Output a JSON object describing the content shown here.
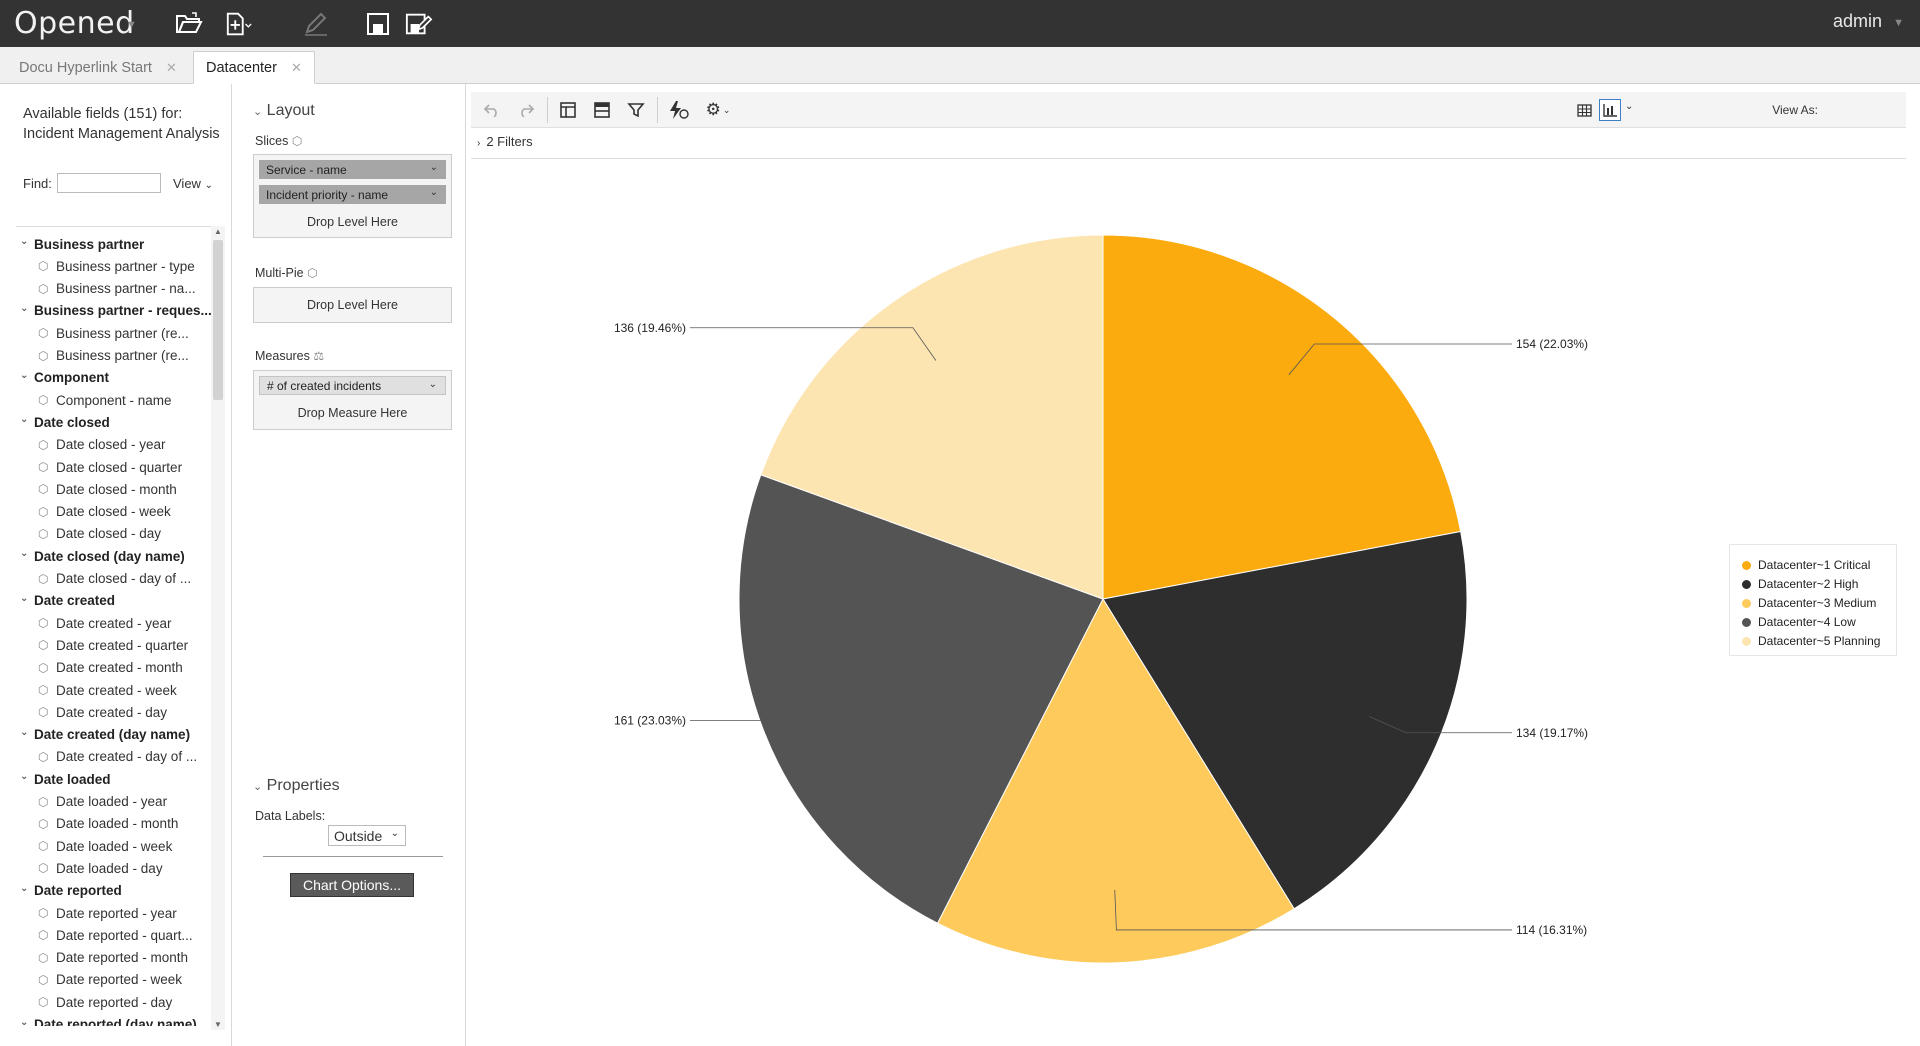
{
  "header": {
    "title": "Opened",
    "user": "admin"
  },
  "tabs": [
    {
      "label": "Docu Hyperlink Start"
    },
    {
      "label": "Datacenter"
    }
  ],
  "fields": {
    "available": "Available fields (151) for: Incident Management Analysis",
    "find_label": "Find:",
    "view_label": "View",
    "tree": [
      {
        "label": "Business partner",
        "group": true
      },
      {
        "label": "Business partner - type",
        "group": false
      },
      {
        "label": "Business partner - na...",
        "group": false
      },
      {
        "label": "Business partner - reques...",
        "group": true
      },
      {
        "label": "Business partner (re...",
        "group": false
      },
      {
        "label": "Business partner (re...",
        "group": false
      },
      {
        "label": "Component",
        "group": true
      },
      {
        "label": "Component - name",
        "group": false
      },
      {
        "label": "Date closed",
        "group": true
      },
      {
        "label": "Date closed - year",
        "group": false
      },
      {
        "label": "Date closed - quarter",
        "group": false
      },
      {
        "label": "Date closed - month",
        "group": false
      },
      {
        "label": "Date closed - week",
        "group": false
      },
      {
        "label": "Date closed - day",
        "group": false
      },
      {
        "label": "Date closed (day name)",
        "group": true
      },
      {
        "label": "Date closed - day of ...",
        "group": false
      },
      {
        "label": "Date created",
        "group": true
      },
      {
        "label": "Date created - year",
        "group": false
      },
      {
        "label": "Date created - quarter",
        "group": false
      },
      {
        "label": "Date created - month",
        "group": false
      },
      {
        "label": "Date created - week",
        "group": false
      },
      {
        "label": "Date created - day",
        "group": false
      },
      {
        "label": "Date created (day name)",
        "group": true
      },
      {
        "label": "Date created - day of ...",
        "group": false
      },
      {
        "label": "Date loaded",
        "group": true
      },
      {
        "label": "Date loaded - year",
        "group": false
      },
      {
        "label": "Date loaded - month",
        "group": false
      },
      {
        "label": "Date loaded - week",
        "group": false
      },
      {
        "label": "Date loaded - day",
        "group": false
      },
      {
        "label": "Date reported",
        "group": true
      },
      {
        "label": "Date reported - year",
        "group": false
      },
      {
        "label": "Date reported - quart...",
        "group": false
      },
      {
        "label": "Date reported - month",
        "group": false
      },
      {
        "label": "Date reported - week",
        "group": false
      },
      {
        "label": "Date reported - day",
        "group": false
      },
      {
        "label": "Date reported (day name)",
        "group": true
      }
    ]
  },
  "layout": {
    "title": "Layout",
    "slices_label": "Slices",
    "slices": [
      "Service - name",
      "Incident priority - name"
    ],
    "drop_level": "Drop Level Here",
    "multipie_label": "Multi-Pie",
    "measures_label": "Measures",
    "measures": [
      "# of created incidents"
    ],
    "drop_measure": "Drop Measure Here"
  },
  "properties": {
    "title": "Properties",
    "data_labels_label": "Data Labels:",
    "data_labels_value": "Outside",
    "chart_options": "Chart Options..."
  },
  "toolbar": {
    "view_as": "View As:",
    "filters": "2 Filters"
  },
  "chart_data": {
    "type": "pie",
    "categories": [
      "Datacenter~1 Critical",
      "Datacenter~2 High",
      "Datacenter~3 Medium",
      "Datacenter~4 Low",
      "Datacenter~5 Planning"
    ],
    "values": [
      154,
      134,
      114,
      161,
      136
    ],
    "data_labels": [
      "154 (22.03%)",
      "134 (19.17%)",
      "114 (16.31%)",
      "161 (23.03%)",
      "136 (19.46%)"
    ],
    "colors": [
      "#fbab0d",
      "#2e2e2e",
      "#fdca5b",
      "#545454",
      "#fde5b2"
    ],
    "legend_position": "right"
  }
}
